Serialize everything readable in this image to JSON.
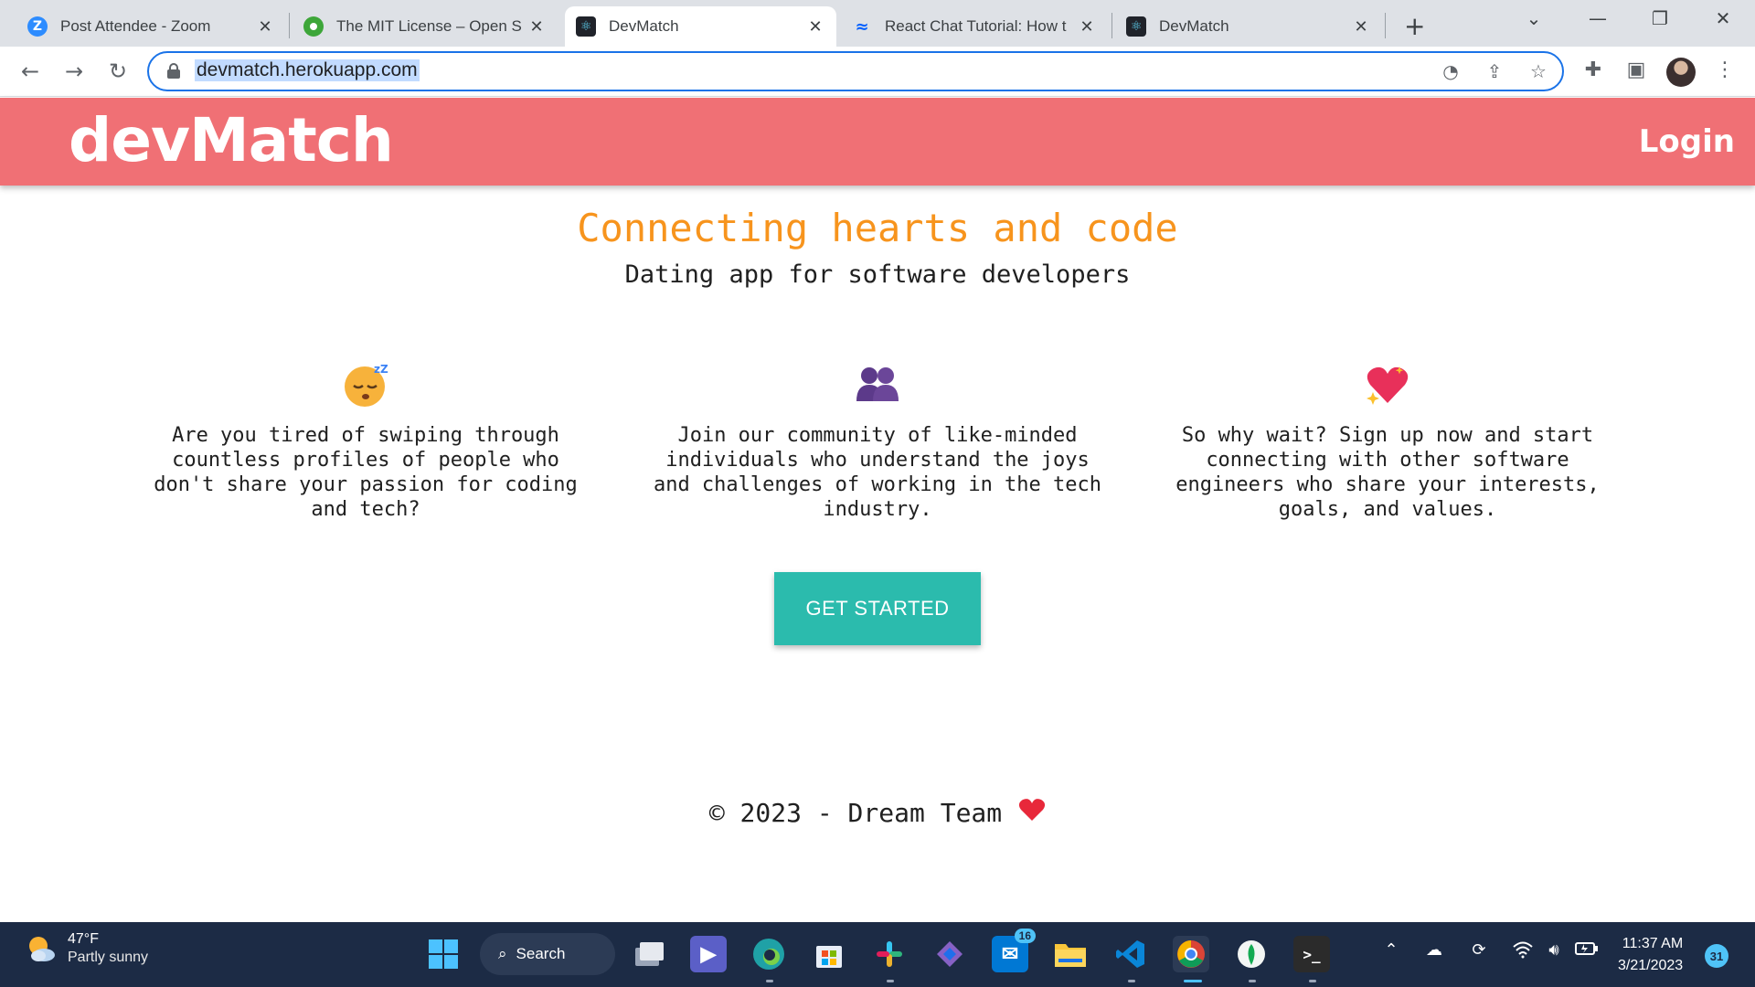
{
  "browser": {
    "tabs": [
      {
        "title": "Post Attendee - Zoom",
        "icon": "zoom-icon",
        "color": "#2d8cff",
        "glyph": "Z",
        "active": false
      },
      {
        "title": "The MIT License – Open S",
        "icon": "osi-icon",
        "color": "#3da639",
        "glyph": "",
        "active": false
      },
      {
        "title": "DevMatch",
        "icon": "react-icon",
        "color": "#20232a",
        "glyph": "⚛",
        "active": true
      },
      {
        "title": "React Chat Tutorial: How t",
        "icon": "stream-icon",
        "color": "#005fff",
        "glyph": "≈",
        "active": false
      },
      {
        "title": "DevMatch",
        "icon": "react-icon",
        "color": "#20232a",
        "glyph": "⚛",
        "active": false
      }
    ],
    "url": "devmatch.herokuapp.com"
  },
  "page": {
    "logo": "devMatch",
    "login": "Login",
    "headline": "Connecting hearts and code",
    "subline": "Dating app for software developers",
    "features": [
      {
        "icon": "sleepy-face-icon",
        "text": "Are you tired of swiping through countless profiles of people who don't share your passion for coding and tech?"
      },
      {
        "icon": "two-people-icon",
        "text": "Join our community of like-minded individuals who understand the joys and challenges of working in the tech industry."
      },
      {
        "icon": "sparkling-heart-icon",
        "text": "So why wait? Sign up now and start connecting with other software engineers who share your interests, goals, and values."
      }
    ],
    "cta": "GET STARTED",
    "footer": "© 2023 - Dream Team",
    "colors": {
      "navbar": "#f07075",
      "headline": "#f7941d",
      "cta": "#2bbbad"
    }
  },
  "taskbar": {
    "weather_temp": "47°F",
    "weather_desc": "Partly sunny",
    "search_label": "Search",
    "mail_badge": "16",
    "time": "11:37 AM",
    "date": "3/21/2023",
    "notifications": "31"
  }
}
